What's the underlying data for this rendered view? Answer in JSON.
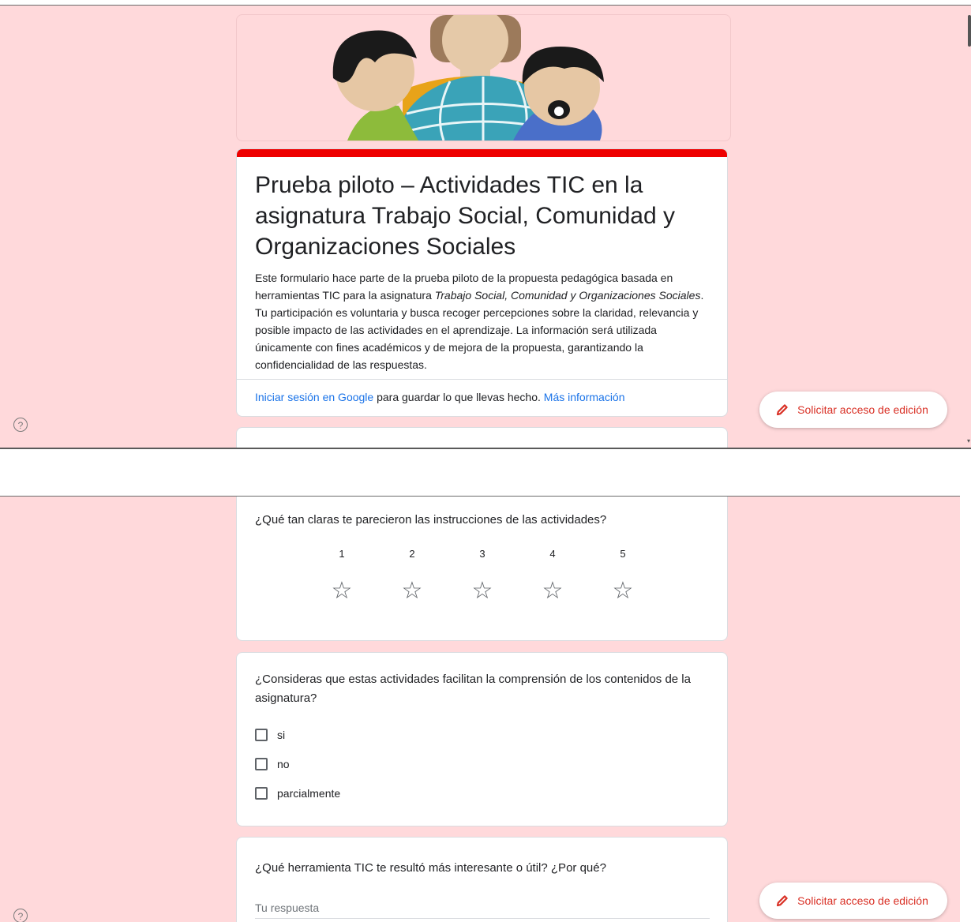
{
  "form": {
    "title": "Prueba piloto – Actividades TIC en la asignatura Trabajo Social, Comunidad y Organizaciones Sociales",
    "description_1": "  Este formulario hace parte de la prueba piloto de la propuesta pedagógica basada en herramientas TIC para la asignatura ",
    "description_italic": "Trabajo Social, Comunidad y Organizaciones Sociales",
    "description_2": ". Tu participación es voluntaria y busca recoger percepciones sobre la claridad, relevancia y posible impacto de las actividades en el aprendizaje. La información será utilizada únicamente con fines académicos y de mejora de la propuesta, garantizando la confidencialidad de las respuestas.",
    "signin_link": "Iniciar sesión en Google",
    "signin_text": " para guardar lo que llevas hecho. ",
    "more_info_link": "Más información",
    "accent_color": "#ee0000",
    "background_color": "#ffd9db"
  },
  "toolbar": {
    "edit_access_label": "Solicitar acceso de edición",
    "help_icon": "?"
  },
  "questions": [
    {
      "text": "¿Qué tan claras te parecieron las instrucciones de las actividades?",
      "type": "rating",
      "scale": [
        "1",
        "2",
        "3",
        "4",
        "5"
      ],
      "icon": "star-outline-icon",
      "star_glyph": "☆"
    },
    {
      "text": "¿Consideras que estas actividades facilitan la comprensión de los contenidos de la asignatura?",
      "type": "checkbox",
      "options": [
        "si",
        "no",
        "parcialmente"
      ]
    },
    {
      "text": "¿Qué herramienta TIC te resultó más interesante o útil? ¿Por qué?",
      "type": "short_text",
      "placeholder": "Tu respuesta"
    }
  ]
}
